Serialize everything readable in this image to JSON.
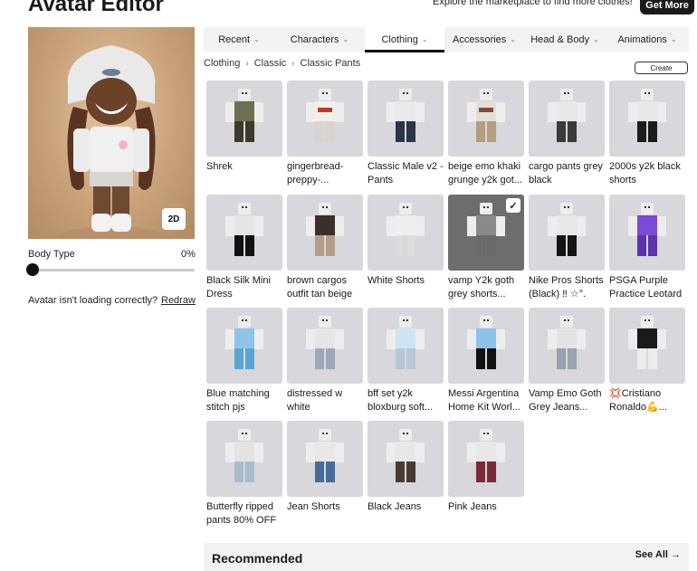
{
  "header": {
    "title": "Avatar Editor",
    "marketplace_text": "Explore the marketplace to find more clothes!",
    "get_more_label": "Get More"
  },
  "preview": {
    "mode_button": "2D"
  },
  "body_type": {
    "label": "Body Type",
    "value": "0%",
    "value_fraction": 0
  },
  "loading": {
    "message": "Avatar isn't loading correctly?",
    "redraw_label": "Redraw"
  },
  "tabs": [
    {
      "label": "Recent",
      "active": false
    },
    {
      "label": "Characters",
      "active": false
    },
    {
      "label": "Clothing",
      "active": true
    },
    {
      "label": "Accessories",
      "active": false
    },
    {
      "label": "Head & Body",
      "active": false
    },
    {
      "label": "Animations",
      "active": false
    }
  ],
  "breadcrumb": [
    "Clothing",
    "Classic",
    "Classic Pants"
  ],
  "create_label": "Create",
  "items": [
    {
      "name": "Shrek",
      "top": "#6d7050",
      "bottom": "#3d3a2c",
      "selected": false
    },
    {
      "name": "gingerbread-preppy-...",
      "top": "#f1efec",
      "bottom": "#d8d4cf",
      "accent": "#c0392b",
      "selected": false
    },
    {
      "name": "Classic Male v2 - Pants",
      "top": "#e9e9ea",
      "bottom": "#2c3547",
      "selected": false
    },
    {
      "name": "beige emo khaki grunge y2k got...",
      "top": "#e4dfd6",
      "bottom": "#b59d7f",
      "accent": "#8a4a3a",
      "selected": false
    },
    {
      "name": "cargo pants grey black",
      "top": "#e8e8e8",
      "bottom": "#3a3a3a",
      "selected": false
    },
    {
      "name": "2000s y2k black shorts",
      "top": "#e8e8e8",
      "bottom": "#1c1c1c",
      "selected": false
    },
    {
      "name": "Black Silk Mini Dress necklace...",
      "top": "#e5e5e5",
      "bottom": "#111111",
      "selected": false
    },
    {
      "name": "brown cargos outfit tan beige",
      "top": "#3a2f2a",
      "bottom": "#b59c89",
      "selected": false
    },
    {
      "name": "White Shorts",
      "top": "#efefef",
      "bottom": "#dcdcdc",
      "selected": false
    },
    {
      "name": "vamp Y2k goth grey shorts...",
      "top": "#8a8a8a",
      "bottom": "#6a6a6a",
      "selected": true
    },
    {
      "name": "Nike Pros Shorts (Black) ‼ ☆°.",
      "top": "#e8e8e8",
      "bottom": "#141414",
      "selected": false
    },
    {
      "name": "PSGA Purple Practice Leotard",
      "top": "#7c4bd6",
      "bottom": "#5b33aa",
      "selected": false
    },
    {
      "name": "Blue matching stitch pjs",
      "top": "#8fc3e8",
      "bottom": "#5aa5d6",
      "selected": false
    },
    {
      "name": "distressed w white",
      "top": "#e5e5e5",
      "bottom": "#9fa8b8",
      "selected": false
    },
    {
      "name": "bff set y2k bloxburg soft...",
      "top": "#cfe4f2",
      "bottom": "#b7c7d6",
      "selected": false
    },
    {
      "name": "Messi Argentina Home Kit Worl...",
      "top": "#8ec3e7",
      "bottom": "#111111",
      "selected": false
    },
    {
      "name": "Vamp Emo Goth Grey Jeans...",
      "top": "#e3e3e3",
      "bottom": "#9aa2ad",
      "selected": false
    },
    {
      "name": "💢Cristiano Ronaldo💪...",
      "top": "#1a1a1a",
      "bottom": "#ececec",
      "selected": false
    },
    {
      "name": "Butterfly ripped pants 80% OFF",
      "top": "#e3e3e3",
      "bottom": "#a9bccc",
      "selected": false
    },
    {
      "name": "Jean Shorts",
      "top": "#e8e8e8",
      "bottom": "#4a6b9a",
      "selected": false
    },
    {
      "name": "Black Jeans",
      "top": "#e8e8e8",
      "bottom": "#4a3a32",
      "selected": false
    },
    {
      "name": "Pink Jeans",
      "top": "#e8e8e8",
      "bottom": "#7a2a3a",
      "selected": false
    }
  ],
  "recommended": {
    "title": "Recommended",
    "see_all_label": "See All →"
  },
  "colors": {
    "tab_active_underline": "#111111",
    "thumb_bg": "#d7d7dc",
    "dark_button": "#1a1a1a"
  }
}
